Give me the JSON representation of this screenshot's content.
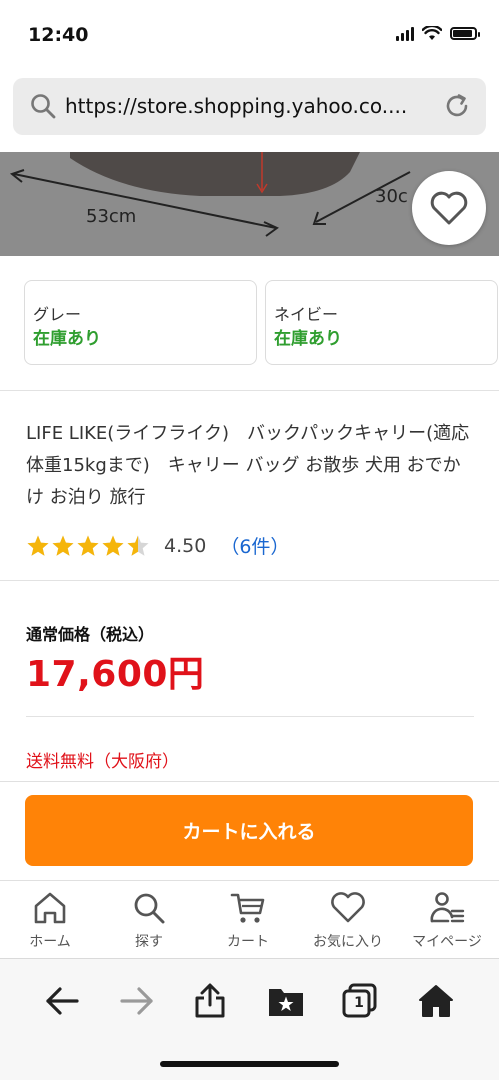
{
  "status_bar": {
    "time": "12:40"
  },
  "browser": {
    "url": "https://store.shopping.yahoo.co...."
  },
  "product_image": {
    "dim_width": "53cm",
    "dim_depth": "30c"
  },
  "variants": [
    {
      "name": "グレー",
      "stock": "在庫あり"
    },
    {
      "name": "ネイビー",
      "stock": "在庫あり"
    }
  ],
  "product": {
    "title": "LIFE LIKE(ライフライク)　バックパックキャリー(適応体重15kgまで)　キャリー バッグ お散歩 犬用 おでかけ お泊り 旅行",
    "rating_value": 4.5,
    "rating_text": "4.50",
    "review_count": "（6件）"
  },
  "price": {
    "label": "通常価格（税込）",
    "amount": "17,600円"
  },
  "shipping": {
    "text": "送料無料（大阪府）"
  },
  "cart_button": {
    "label": "カートに入れる"
  },
  "app_nav": [
    {
      "label": "ホーム",
      "icon": "home-outline-icon"
    },
    {
      "label": "探す",
      "icon": "search-icon"
    },
    {
      "label": "カート",
      "icon": "cart-icon"
    },
    {
      "label": "お気に入り",
      "icon": "heart-icon"
    },
    {
      "label": "マイページ",
      "icon": "user-list-icon"
    }
  ],
  "colors": {
    "accent": "#ff8307",
    "price": "#e0121a",
    "stock": "#2f9e2f",
    "link": "#1a67d0",
    "star": "#f5b50a"
  },
  "safari_toolbar": {
    "tabs_count": "1"
  }
}
